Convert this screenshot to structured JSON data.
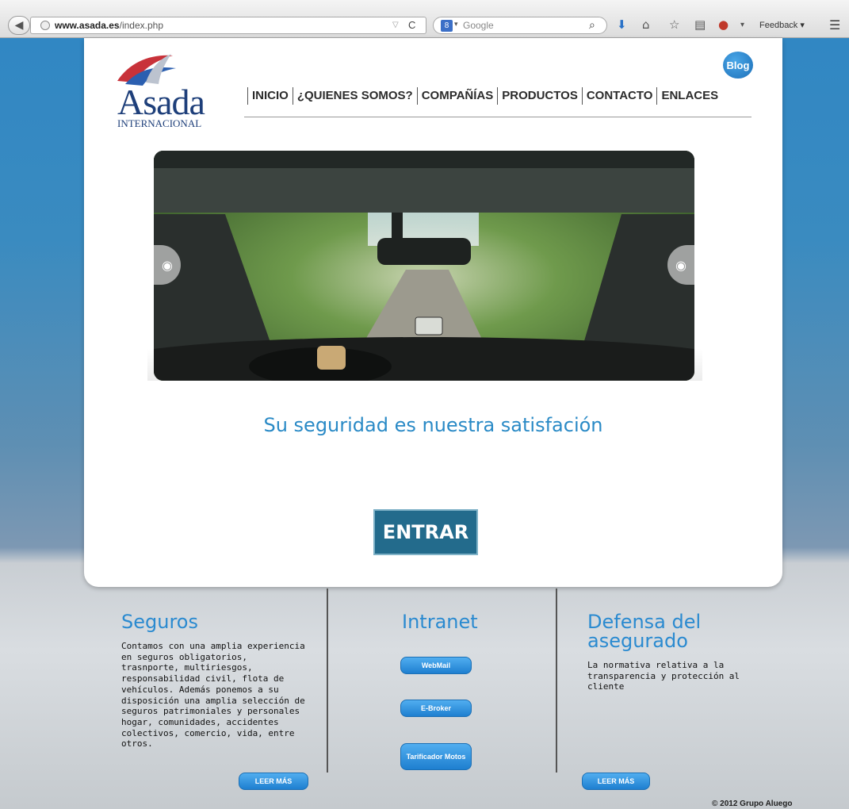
{
  "browser": {
    "url_domain": "www.asada.es",
    "url_path": "/index.php",
    "search_placeholder": "Google",
    "search_engine_icon": "8",
    "feedback_label": "Feedback"
  },
  "site": {
    "logo_word": "Asada",
    "logo_sub": "INTERNACIONAL",
    "blog_label": "Blog",
    "nav": [
      "INICIO",
      "¿QUIENES SOMOS?",
      "COMPAÑÍAS",
      "PRODUCTOS",
      "CONTACTO",
      "ENLACES"
    ],
    "tagline": "Su seguridad es nuestra satisfación",
    "enter_label": "ENTRAR"
  },
  "footer": {
    "seguros": {
      "title": "Seguros",
      "body": "Contamos con una amplia experiencia en seguros obligatorios, trasnporte, multiriesgos, responsabilidad civil, flota de vehículos. Además ponemos a su disposición una amplia selección de seguros patrimoniales y personales hogar, comunidades, accidentes colectivos, comercio, vida, entre otros.",
      "more_label": "LEER MÁS"
    },
    "intranet": {
      "title": "Intranet",
      "webmail_label": "WebMail",
      "ebroker_label": "E-Broker",
      "tarificador_label": "Tarificador Motos"
    },
    "defensa": {
      "title": "Defensa del asegurado",
      "body": "La normativa relativa a la transparencia y protección al cliente",
      "more_label": "LEER MÁS"
    },
    "copyright": "© 2012 Grupo Aluego"
  },
  "colors": {
    "accent": "#2a8ac6",
    "logo_blue": "#1e3f7a",
    "enter_button": "#236b8c",
    "pill_button": "#1e7fd0"
  }
}
